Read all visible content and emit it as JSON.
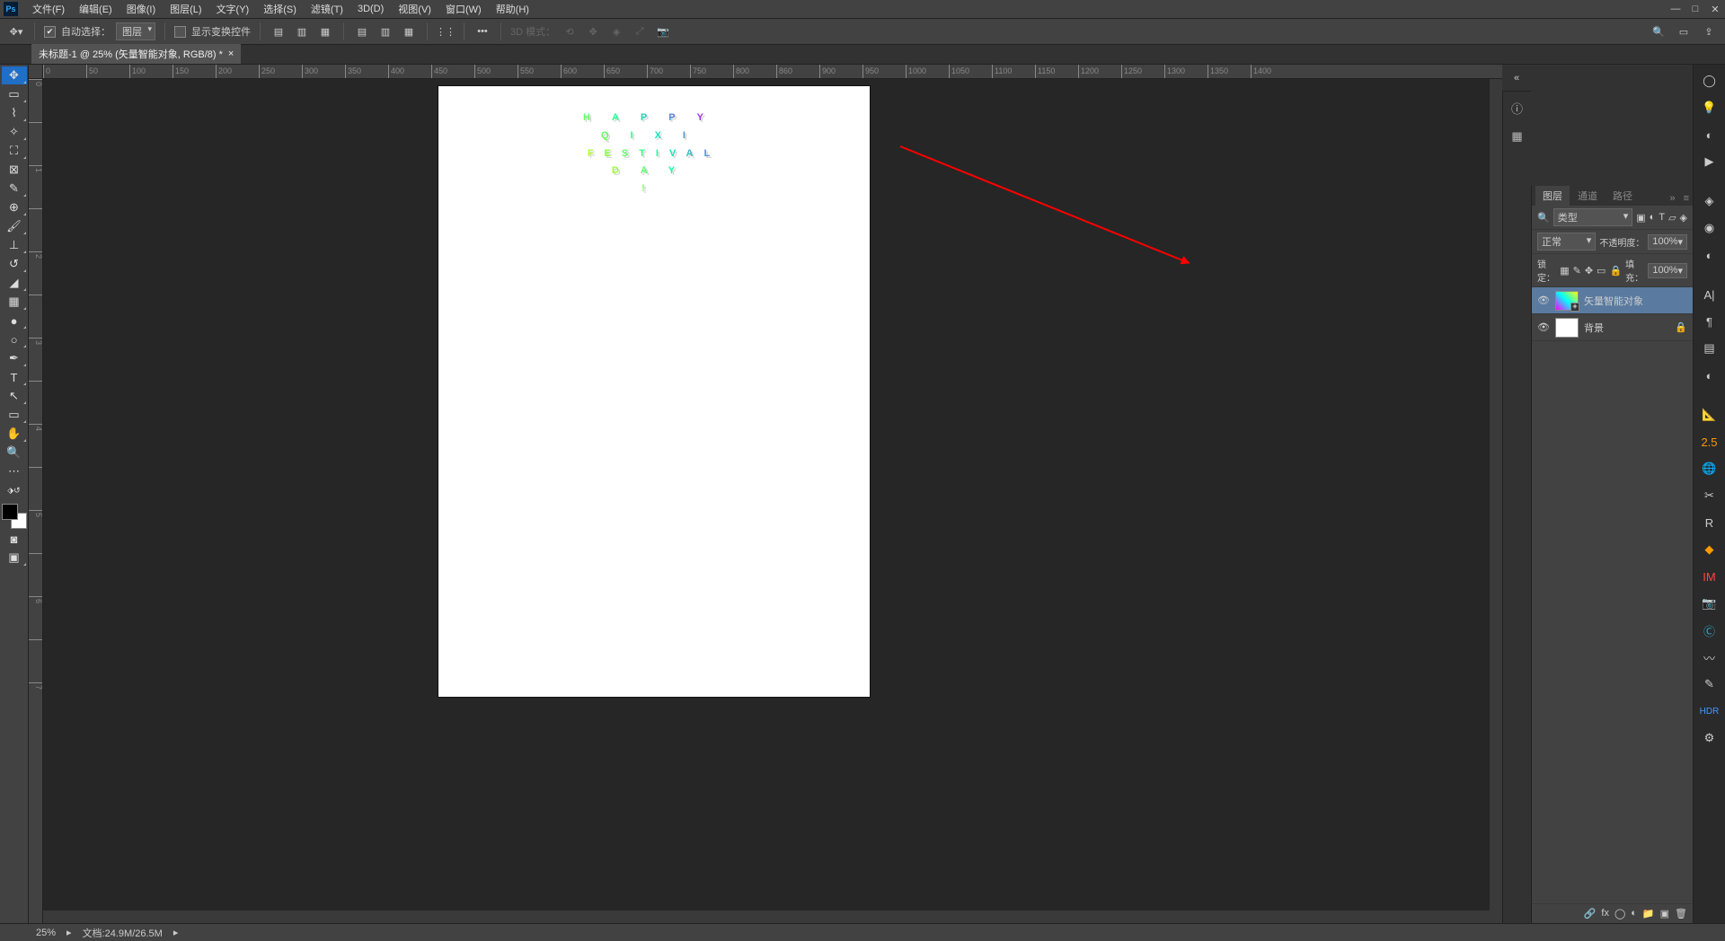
{
  "menubar": {
    "items": [
      "文件(F)",
      "编辑(E)",
      "图像(I)",
      "图层(L)",
      "文字(Y)",
      "选择(S)",
      "滤镜(T)",
      "3D(D)",
      "视图(V)",
      "窗口(W)",
      "帮助(H)"
    ]
  },
  "optionsbar": {
    "autoSelectLabel": "自动选择：",
    "autoSelectChecked": true,
    "targetSelect": "图层",
    "showTransformLabel": "显示变换控件",
    "showTransformChecked": false,
    "mode3dLabel": "3D 模式："
  },
  "docTab": {
    "title": "未标题-1 @ 25% (矢量智能对象, RGB/8) *"
  },
  "canvas": {
    "line1": "HAPPY",
    "line2": "QIXI",
    "line3": "FESTIVAL",
    "line4": "DAY",
    "line5": "!"
  },
  "rulersH": [
    "0",
    "50",
    "100",
    "150",
    "200",
    "250",
    "300",
    "350",
    "400",
    "450",
    "500",
    "550",
    "600",
    "650",
    "700",
    "750",
    "800",
    "860",
    "900",
    "950",
    "1000",
    "1050",
    "1100",
    "1150",
    "1200",
    "1250",
    "1300",
    "1350",
    "1400"
  ],
  "rulersV": [
    "0",
    "",
    "1",
    "",
    "2",
    "",
    "3",
    "",
    "4",
    "",
    "5",
    "",
    "6",
    "",
    "7"
  ],
  "layersPanel": {
    "tabs": [
      "图层",
      "通道",
      "路径"
    ],
    "filterLabel": "类型",
    "blendMode": "正常",
    "opacityLabel": "不透明度：",
    "opacityValue": "100%",
    "lockLabel": "锁定：",
    "fillLabel": "填充：",
    "fillValue": "100%",
    "layers": [
      {
        "name": "矢量智能对象",
        "visible": true,
        "selected": true,
        "smartObject": true
      },
      {
        "name": "背景",
        "visible": true,
        "selected": false,
        "locked": true
      }
    ]
  },
  "statusbar": {
    "zoom": "25%",
    "docSize": "文档:24.9M/26.5M"
  },
  "rightRail": {
    "items": [
      "info-icon",
      "grid-icon",
      "",
      "cc-icon",
      "bulb-icon",
      "headphones-icon",
      "play-icon",
      "",
      "layers-icon",
      "share-icon",
      "adjust-icon",
      "",
      "type-char-icon",
      "para-icon",
      "glyph-icon",
      "contrast-icon",
      "",
      "measure-icon",
      "2.5-icon",
      "globe-icon",
      "scissors-icon",
      "r-icon",
      "diamond-icon",
      "im-icon",
      "camera-icon",
      "c-icon",
      "wave-icon",
      "brush-icon",
      "hdr-icon",
      "gear-icon"
    ]
  },
  "colors": {
    "panelBg": "#424242",
    "darkBg": "#323232",
    "selected": "#5a7aa0",
    "accent": "#1f6ec8",
    "text": "#cccccc"
  }
}
